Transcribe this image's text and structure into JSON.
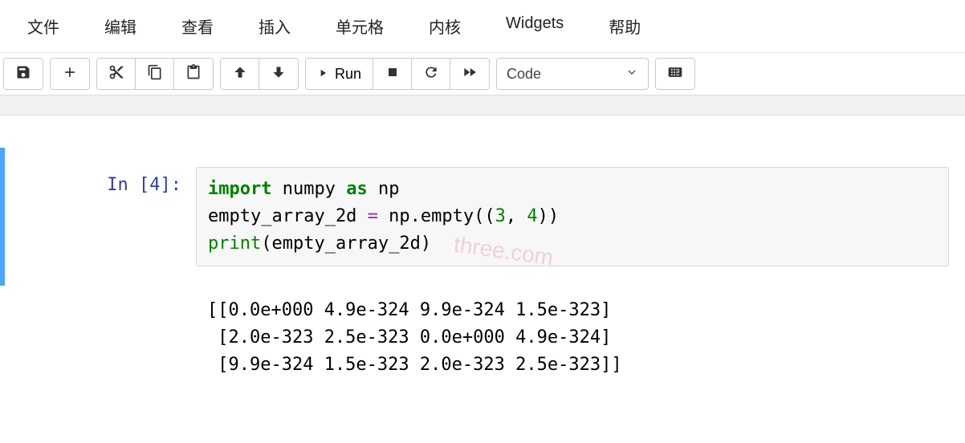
{
  "menu": {
    "file": "文件",
    "edit": "编辑",
    "view": "查看",
    "insert": "插入",
    "cell": "单元格",
    "kernel": "内核",
    "widgets": "Widgets",
    "help": "帮助"
  },
  "toolbar": {
    "run_label": "Run",
    "celltype": "Code"
  },
  "cell": {
    "prompt_label": "In [4]:",
    "code": {
      "l1_import": "import",
      "l1_numpy": " numpy ",
      "l1_as": "as",
      "l1_np": " np",
      "l2": "",
      "l3_pre": "empty_array_2d ",
      "l3_eq": "=",
      "l3_post": " np.empty((",
      "l3_n1": "3",
      "l3_comma": ", ",
      "l3_n2": "4",
      "l3_end": "))",
      "l4_print": "print",
      "l4_rest": "(empty_array_2d)"
    },
    "output": "[[0.0e+000 4.9e-324 9.9e-324 1.5e-323]\n [2.0e-323 2.5e-323 0.0e+000 4.9e-324]\n [9.9e-324 1.5e-323 2.0e-323 2.5e-323]]"
  },
  "watermark": "three.com"
}
